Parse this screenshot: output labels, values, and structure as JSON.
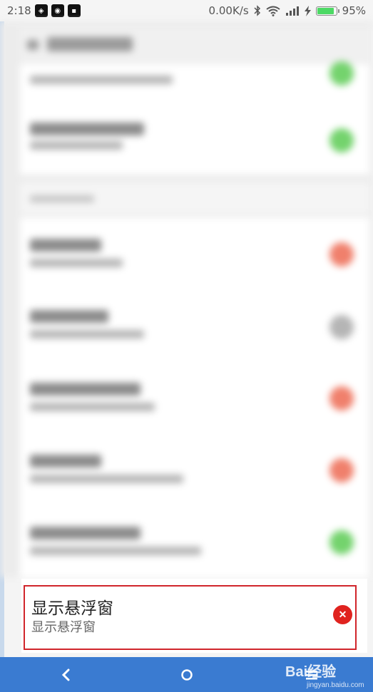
{
  "status_bar": {
    "time": "2:18",
    "network_speed": "0.00K/s",
    "battery_percent": "95%",
    "battery_level": 0.95,
    "icons": [
      "notification-icon",
      "notification-icon",
      "notification-icon",
      "bluetooth-icon",
      "wifi-icon",
      "signal-icon",
      "charging-icon",
      "battery-icon"
    ]
  },
  "colors": {
    "accent_blue": "#3a7bd1",
    "toggle_on": "#74d36d",
    "toggle_off_red": "#f0806c",
    "toggle_grey": "#b5b5b5",
    "highlight_red": "#d0252b",
    "close_red": "#e0231f"
  },
  "focused_item": {
    "title": "显示悬浮窗",
    "subtitle": "显示悬浮窗",
    "action_icon": "close-icon"
  },
  "nav_bar": {
    "buttons": [
      "back-icon",
      "home-icon",
      "menu-icon"
    ]
  },
  "watermark": {
    "brand": "Bai经验",
    "url": "jingyan.baidu.com"
  }
}
